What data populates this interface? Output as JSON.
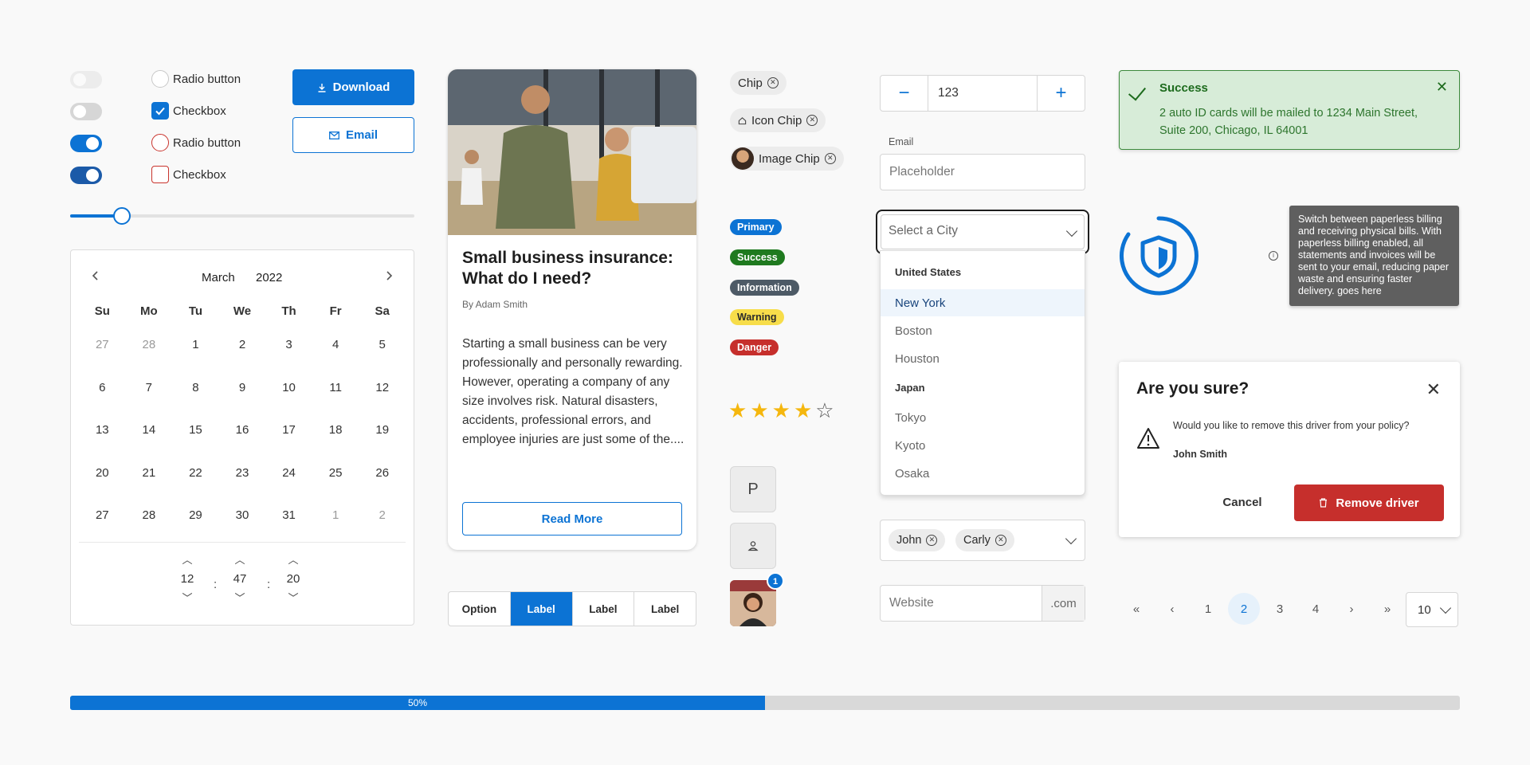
{
  "controls": {
    "radio1_label": "Radio button",
    "checkbox1_label": "Checkbox",
    "radio2_label": "Radio button",
    "checkbox2_label": "Checkbox",
    "download_label": "Download",
    "email_label": "Email"
  },
  "slider": {
    "value_fraction": 0.15
  },
  "calendar": {
    "month": "March",
    "year": "2022",
    "weekdays": [
      "Su",
      "Mo",
      "Tu",
      "We",
      "Th",
      "Fr",
      "Sa"
    ],
    "days": [
      {
        "d": "27",
        "dim": true
      },
      {
        "d": "28",
        "dim": true
      },
      {
        "d": "1"
      },
      {
        "d": "2"
      },
      {
        "d": "3"
      },
      {
        "d": "4"
      },
      {
        "d": "5"
      },
      {
        "d": "6"
      },
      {
        "d": "7"
      },
      {
        "d": "8"
      },
      {
        "d": "9"
      },
      {
        "d": "10"
      },
      {
        "d": "11"
      },
      {
        "d": "12"
      },
      {
        "d": "13"
      },
      {
        "d": "14"
      },
      {
        "d": "15"
      },
      {
        "d": "16"
      },
      {
        "d": "17"
      },
      {
        "d": "18"
      },
      {
        "d": "19"
      },
      {
        "d": "20"
      },
      {
        "d": "21"
      },
      {
        "d": "22"
      },
      {
        "d": "23"
      },
      {
        "d": "24"
      },
      {
        "d": "25"
      },
      {
        "d": "26"
      },
      {
        "d": "27"
      },
      {
        "d": "28"
      },
      {
        "d": "29"
      },
      {
        "d": "30"
      },
      {
        "d": "31"
      },
      {
        "d": "1",
        "dim": true
      },
      {
        "d": "2",
        "dim": true
      }
    ],
    "time": {
      "hour": "12",
      "minute": "47",
      "second": "20",
      "separator": ":"
    }
  },
  "article": {
    "title": "Small business insurance: What do I need?",
    "author": "By Adam Smith",
    "body": "Starting a small business can be very professionally and personally rewarding. However, operating a company of any size involves risk. Natural disasters, accidents, professional errors, and employee injuries are just some of the....",
    "button": "Read More"
  },
  "segmented": [
    "Option",
    "Label",
    "Label",
    "Label"
  ],
  "chips": {
    "chip": "Chip",
    "icon_chip": "Icon Chip",
    "image_chip": "Image Chip"
  },
  "badges": {
    "primary": "Primary",
    "success": "Success",
    "information": "Information",
    "warning": "Warning",
    "danger": "Danger"
  },
  "colors": {
    "primary": "#0c73d4",
    "success": "#1f7a1f",
    "information": "#4d5a66",
    "warning": "#f7dd4a",
    "danger": "#c62f2c"
  },
  "rating": {
    "value": 4,
    "max": 5
  },
  "avatars": {
    "initial": "P",
    "notification_count": "1"
  },
  "form": {
    "stepper_value": "123",
    "email_label": "Email",
    "email_placeholder": "Placeholder",
    "city_placeholder": "Select a City",
    "dropdown": {
      "group1": "United States",
      "us_cities": [
        "New York",
        "Boston",
        "Houston"
      ],
      "group2": "Japan",
      "jp_cities": [
        "Tokyo",
        "Kyoto",
        "Osaka"
      ]
    },
    "multi_chips": [
      "John",
      "Carly"
    ],
    "website_placeholder": "Website",
    "website_suffix": ".com"
  },
  "alert": {
    "title": "Success",
    "message": "2 auto ID cards will be mailed to 1234 Main Street, Suite 200, Chicago, IL 64001"
  },
  "tooltip": {
    "text": "Switch between paperless billing and receiving physical bills. With paperless billing enabled, all statements and invoices will be sent to your email, reducing paper waste and ensuring faster delivery. goes here"
  },
  "modal": {
    "title": "Are you sure?",
    "question": "Would you like to remove this driver from your policy?",
    "name": "John Smith",
    "cancel": "Cancel",
    "remove": "Remove driver"
  },
  "pagination": {
    "pages": [
      "1",
      "2",
      "3",
      "4"
    ],
    "page_size": "10"
  },
  "progress": {
    "value": 0.5,
    "label": "50%"
  }
}
